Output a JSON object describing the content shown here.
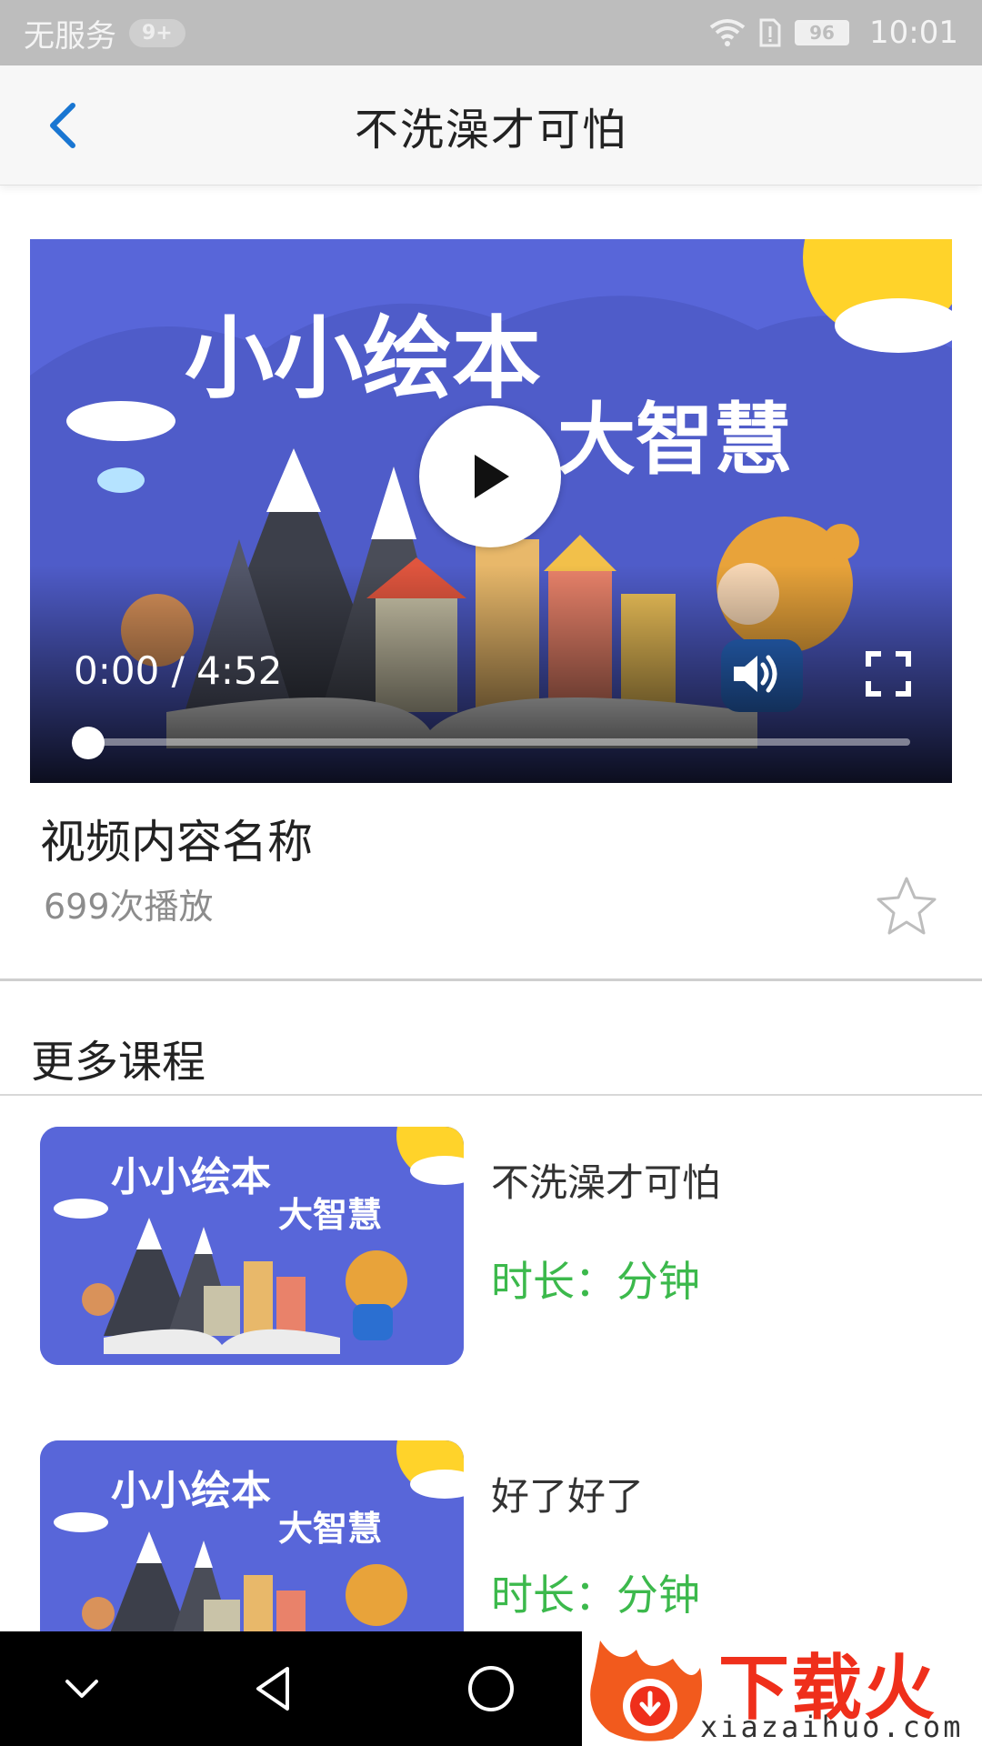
{
  "status_bar": {
    "carrier": "无服务",
    "notification_count": "9+",
    "battery": "96",
    "time": "10:01"
  },
  "header": {
    "title": "不洗澡才可怕"
  },
  "player": {
    "time": "0:00 / 4:52",
    "progress": 0,
    "thumbnail_title_line1": "小小绘本",
    "thumbnail_title_line2": "大智慧"
  },
  "video_info": {
    "title": "视频内容名称",
    "play_count": "699次播放"
  },
  "more_courses": {
    "heading": "更多课程",
    "items": [
      {
        "name": "不洗澡才可怕",
        "duration": "时长：分钟",
        "thumb_line1": "小小绘本",
        "thumb_line2": "大智慧"
      },
      {
        "name": "好了好了",
        "duration": "时长：分钟",
        "thumb_line1": "小小绘本",
        "thumb_line2": "大智慧"
      }
    ]
  },
  "watermark": {
    "name": "下载火",
    "domain": "xiazaihuo.com"
  },
  "colors": {
    "accent_blue": "#1976d2",
    "duration_green": "#3cb94c",
    "thumbnail_blue": "#5866d9"
  }
}
